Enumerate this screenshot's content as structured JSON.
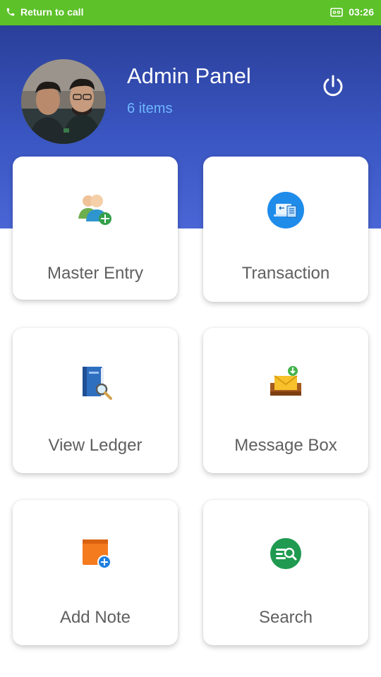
{
  "status_bar": {
    "call_text": "Return to call",
    "time": "03:26"
  },
  "header": {
    "title": "Admin Panel",
    "subtitle": "6 items"
  },
  "tiles": [
    {
      "label": "Master Entry",
      "icon": "add-user-icon"
    },
    {
      "label": "Transaction",
      "icon": "transaction-icon"
    },
    {
      "label": "View Ledger",
      "icon": "ledger-book-icon"
    },
    {
      "label": "Message Box",
      "icon": "message-inbox-icon"
    },
    {
      "label": "Add Note",
      "icon": "add-note-icon"
    },
    {
      "label": "Search",
      "icon": "search-icon"
    }
  ],
  "colors": {
    "status_bar": "#5dc12a",
    "header_top": "#2a3f99",
    "header_bottom": "#4a66d6",
    "subtitle": "#6fb6ff"
  }
}
